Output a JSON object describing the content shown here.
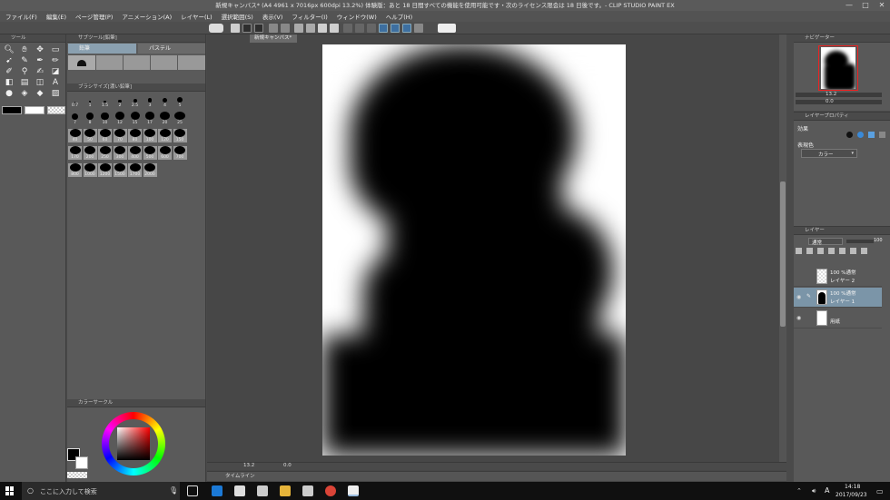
{
  "window": {
    "title": "新規キャンバス* (A4 4961 x 7016px 600dpi 13.2%)  体験版：あと 18 日間すべての機能を使用可能です・次のライセンス限会は 18 日後です。- CLIP STUDIO PAINT EX",
    "controls": [
      "—",
      "□",
      "✕"
    ]
  },
  "menubar": {
    "items": [
      "ファイル(F)",
      "編集(E)",
      "ページ管理(P)",
      "アニメーション(A)",
      "レイヤー(L)",
      "選択範囲(S)",
      "表示(V)",
      "フィルター(I)",
      "ウィンドウ(W)",
      "ヘルプ(H)"
    ]
  },
  "tool_panel": {
    "header": "ツール",
    "tools": [
      "zoom-icon",
      "hand-icon",
      "move-icon",
      "select-icon",
      "lasso-icon",
      "eyedropper-icon",
      "pen-icon",
      "pencil-icon",
      "brush-icon",
      "airbrush-icon",
      "blend-icon",
      "eraser-icon",
      "fill-icon",
      "gradient-icon",
      "shape-icon",
      "text-icon",
      "frame-icon",
      "ruler-icon",
      "correct-icon",
      "balloon-icon"
    ]
  },
  "subtool_panel": {
    "header": "サブツール[鉛筆]",
    "tabs": [
      "鉛筆",
      "パステル"
    ]
  },
  "brushsize_panel": {
    "header": "ブラシサイズ[濃い鉛筆]",
    "sizes": [
      "0.7",
      "1",
      "1.5",
      "2",
      "2.5",
      "3",
      "4",
      "5",
      "7",
      "8",
      "10",
      "12",
      "15",
      "17",
      "20",
      "25",
      "40",
      "50",
      "60",
      "70",
      "80",
      "100",
      "120",
      "150",
      "170",
      "200",
      "250",
      "300",
      "400",
      "500",
      "600",
      "700",
      "800",
      "1000",
      "1200",
      "1500",
      "1700",
      "2000"
    ]
  },
  "colorwheel_panel": {
    "header": "カラーサークル"
  },
  "document": {
    "tab_label": "新規キャンバス*",
    "zoom": "13.2",
    "angle": "0.0"
  },
  "timeline": {
    "label": "タイムライン"
  },
  "navigator": {
    "header": "ナビゲーター",
    "zoom": "13.2",
    "angle": "0.0"
  },
  "layer_property": {
    "header": "レイヤープロパティ",
    "effect_label": "効果",
    "color_label": "表現色",
    "color_value": "カラー"
  },
  "layer_panel": {
    "header": "レイヤー",
    "blend_mode": "通常",
    "opacity": "100",
    "layers": [
      {
        "mode": "100 %通常",
        "name": "レイヤー 2",
        "selected": false
      },
      {
        "mode": "100 %通常",
        "name": "レイヤー 1",
        "selected": true
      },
      {
        "mode": "",
        "name": "用紙",
        "selected": false
      }
    ]
  },
  "taskbar": {
    "search_placeholder": "ここに入力して検索",
    "time": "14:18",
    "date": "2017/09/23",
    "ime": "A"
  },
  "colors": {
    "ui_dark": "#4a4a4a",
    "ui_panel": "#595959",
    "selected_layer": "#7b95a8",
    "main_color": "#000000",
    "sub_color": "#ffffff"
  }
}
